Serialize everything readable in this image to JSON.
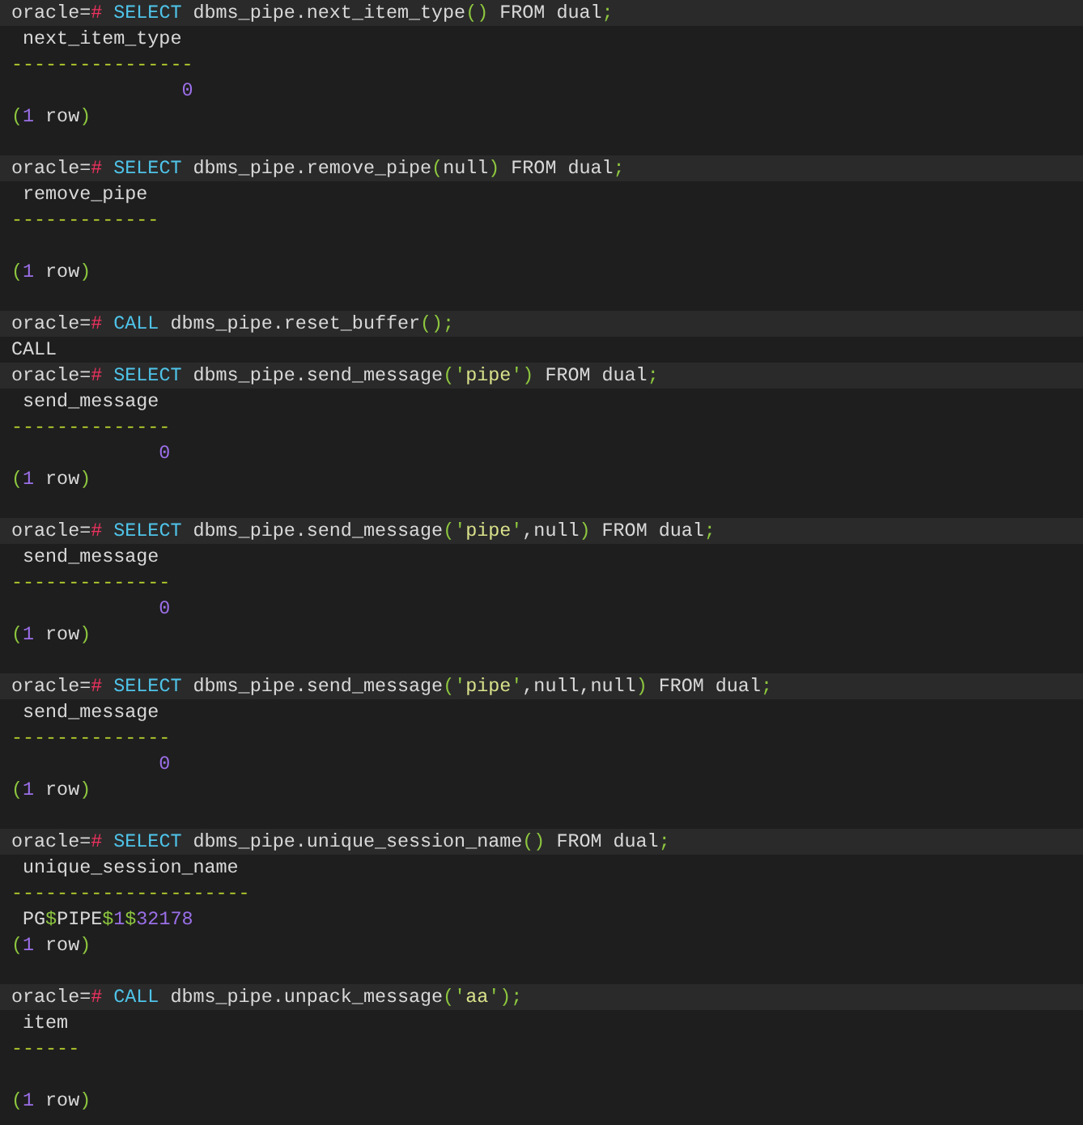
{
  "terminal": {
    "lines": [
      {
        "kind": "command",
        "tokens": [
          {
            "kind": "plain",
            "text": "oracle="
          },
          {
            "kind": "hash",
            "text": "#"
          },
          {
            "kind": "keyword",
            "text": " SELECT"
          },
          {
            "kind": "plain",
            "text": " dbms_pipe.next_item_type"
          },
          {
            "kind": "punct",
            "text": "()"
          },
          {
            "kind": "plain",
            "text": " FROM dual"
          },
          {
            "kind": "punct",
            "text": ";"
          }
        ]
      },
      {
        "kind": "header",
        "tokens": [
          {
            "kind": "plain",
            "text": " next_item_type"
          }
        ]
      },
      {
        "kind": "rule",
        "tokens": [
          {
            "kind": "dashes",
            "text": "----------------"
          }
        ]
      },
      {
        "kind": "value",
        "tokens": [
          {
            "kind": "number",
            "text": "               0"
          }
        ]
      },
      {
        "kind": "footer",
        "tokens": [
          {
            "kind": "punct",
            "text": "("
          },
          {
            "kind": "number",
            "text": "1"
          },
          {
            "kind": "plain",
            "text": " row"
          },
          {
            "kind": "punct",
            "text": ")"
          }
        ]
      },
      {
        "kind": "blank"
      },
      {
        "kind": "command",
        "tokens": [
          {
            "kind": "plain",
            "text": "oracle="
          },
          {
            "kind": "hash",
            "text": "#"
          },
          {
            "kind": "keyword",
            "text": " SELECT"
          },
          {
            "kind": "plain",
            "text": " dbms_pipe.remove_pipe"
          },
          {
            "kind": "punct",
            "text": "("
          },
          {
            "kind": "plain",
            "text": "null"
          },
          {
            "kind": "punct",
            "text": ")"
          },
          {
            "kind": "plain",
            "text": " FROM dual"
          },
          {
            "kind": "punct",
            "text": ";"
          }
        ]
      },
      {
        "kind": "header",
        "tokens": [
          {
            "kind": "plain",
            "text": " remove_pipe"
          }
        ]
      },
      {
        "kind": "rule",
        "tokens": [
          {
            "kind": "dashes",
            "text": "-------------"
          }
        ]
      },
      {
        "kind": "blank"
      },
      {
        "kind": "footer",
        "tokens": [
          {
            "kind": "punct",
            "text": "("
          },
          {
            "kind": "number",
            "text": "1"
          },
          {
            "kind": "plain",
            "text": " row"
          },
          {
            "kind": "punct",
            "text": ")"
          }
        ]
      },
      {
        "kind": "blank"
      },
      {
        "kind": "command",
        "tokens": [
          {
            "kind": "plain",
            "text": "oracle="
          },
          {
            "kind": "hash",
            "text": "#"
          },
          {
            "kind": "keyword",
            "text": " CALL"
          },
          {
            "kind": "plain",
            "text": " dbms_pipe.reset_buffer"
          },
          {
            "kind": "punct",
            "text": "();"
          }
        ]
      },
      {
        "kind": "echo",
        "tokens": [
          {
            "kind": "plain",
            "text": "CALL"
          }
        ]
      },
      {
        "kind": "command",
        "tokens": [
          {
            "kind": "plain",
            "text": "oracle="
          },
          {
            "kind": "hash",
            "text": "#"
          },
          {
            "kind": "keyword",
            "text": " SELECT"
          },
          {
            "kind": "plain",
            "text": " dbms_pipe.send_message"
          },
          {
            "kind": "punct",
            "text": "('"
          },
          {
            "kind": "string",
            "text": "pipe"
          },
          {
            "kind": "punct",
            "text": "')"
          },
          {
            "kind": "plain",
            "text": " FROM dual"
          },
          {
            "kind": "punct",
            "text": ";"
          }
        ]
      },
      {
        "kind": "header",
        "tokens": [
          {
            "kind": "plain",
            "text": " send_message"
          }
        ]
      },
      {
        "kind": "rule",
        "tokens": [
          {
            "kind": "dashes",
            "text": "--------------"
          }
        ]
      },
      {
        "kind": "value",
        "tokens": [
          {
            "kind": "number",
            "text": "             0"
          }
        ]
      },
      {
        "kind": "footer",
        "tokens": [
          {
            "kind": "punct",
            "text": "("
          },
          {
            "kind": "number",
            "text": "1"
          },
          {
            "kind": "plain",
            "text": " row"
          },
          {
            "kind": "punct",
            "text": ")"
          }
        ]
      },
      {
        "kind": "blank"
      },
      {
        "kind": "command",
        "tokens": [
          {
            "kind": "plain",
            "text": "oracle="
          },
          {
            "kind": "hash",
            "text": "#"
          },
          {
            "kind": "keyword",
            "text": " SELECT"
          },
          {
            "kind": "plain",
            "text": " dbms_pipe.send_message"
          },
          {
            "kind": "punct",
            "text": "('"
          },
          {
            "kind": "string",
            "text": "pipe"
          },
          {
            "kind": "punct",
            "text": "'"
          },
          {
            "kind": "plain",
            "text": ",null"
          },
          {
            "kind": "punct",
            "text": ")"
          },
          {
            "kind": "plain",
            "text": " FROM dual"
          },
          {
            "kind": "punct",
            "text": ";"
          }
        ]
      },
      {
        "kind": "header",
        "tokens": [
          {
            "kind": "plain",
            "text": " send_message"
          }
        ]
      },
      {
        "kind": "rule",
        "tokens": [
          {
            "kind": "dashes",
            "text": "--------------"
          }
        ]
      },
      {
        "kind": "value",
        "tokens": [
          {
            "kind": "number",
            "text": "             0"
          }
        ]
      },
      {
        "kind": "footer",
        "tokens": [
          {
            "kind": "punct",
            "text": "("
          },
          {
            "kind": "number",
            "text": "1"
          },
          {
            "kind": "plain",
            "text": " row"
          },
          {
            "kind": "punct",
            "text": ")"
          }
        ]
      },
      {
        "kind": "blank"
      },
      {
        "kind": "command",
        "tokens": [
          {
            "kind": "plain",
            "text": "oracle="
          },
          {
            "kind": "hash",
            "text": "#"
          },
          {
            "kind": "keyword",
            "text": " SELECT"
          },
          {
            "kind": "plain",
            "text": " dbms_pipe.send_message"
          },
          {
            "kind": "punct",
            "text": "('"
          },
          {
            "kind": "string",
            "text": "pipe"
          },
          {
            "kind": "punct",
            "text": "'"
          },
          {
            "kind": "plain",
            "text": ",null,null"
          },
          {
            "kind": "punct",
            "text": ")"
          },
          {
            "kind": "plain",
            "text": " FROM dual"
          },
          {
            "kind": "punct",
            "text": ";"
          }
        ]
      },
      {
        "kind": "header",
        "tokens": [
          {
            "kind": "plain",
            "text": " send_message"
          }
        ]
      },
      {
        "kind": "rule",
        "tokens": [
          {
            "kind": "dashes",
            "text": "--------------"
          }
        ]
      },
      {
        "kind": "value",
        "tokens": [
          {
            "kind": "number",
            "text": "             0"
          }
        ]
      },
      {
        "kind": "footer",
        "tokens": [
          {
            "kind": "punct",
            "text": "("
          },
          {
            "kind": "number",
            "text": "1"
          },
          {
            "kind": "plain",
            "text": " row"
          },
          {
            "kind": "punct",
            "text": ")"
          }
        ]
      },
      {
        "kind": "blank"
      },
      {
        "kind": "command",
        "tokens": [
          {
            "kind": "plain",
            "text": "oracle="
          },
          {
            "kind": "hash",
            "text": "#"
          },
          {
            "kind": "keyword",
            "text": " SELECT"
          },
          {
            "kind": "plain",
            "text": " dbms_pipe.unique_session_name"
          },
          {
            "kind": "punct",
            "text": "()"
          },
          {
            "kind": "plain",
            "text": " FROM dual"
          },
          {
            "kind": "punct",
            "text": ";"
          }
        ]
      },
      {
        "kind": "header",
        "tokens": [
          {
            "kind": "plain",
            "text": " unique_session_name"
          }
        ]
      },
      {
        "kind": "rule",
        "tokens": [
          {
            "kind": "dashes",
            "text": "---------------------"
          }
        ]
      },
      {
        "kind": "value",
        "tokens": [
          {
            "kind": "plain",
            "text": " PG"
          },
          {
            "kind": "punct",
            "text": "$"
          },
          {
            "kind": "plain",
            "text": "PIPE"
          },
          {
            "kind": "punct",
            "text": "$"
          },
          {
            "kind": "number",
            "text": "1"
          },
          {
            "kind": "punct",
            "text": "$"
          },
          {
            "kind": "number",
            "text": "32178"
          }
        ]
      },
      {
        "kind": "footer",
        "tokens": [
          {
            "kind": "punct",
            "text": "("
          },
          {
            "kind": "number",
            "text": "1"
          },
          {
            "kind": "plain",
            "text": " row"
          },
          {
            "kind": "punct",
            "text": ")"
          }
        ]
      },
      {
        "kind": "blank"
      },
      {
        "kind": "command",
        "tokens": [
          {
            "kind": "plain",
            "text": "oracle="
          },
          {
            "kind": "hash",
            "text": "#"
          },
          {
            "kind": "keyword",
            "text": " CALL"
          },
          {
            "kind": "plain",
            "text": " dbms_pipe.unpack_message"
          },
          {
            "kind": "punct",
            "text": "('"
          },
          {
            "kind": "string",
            "text": "aa"
          },
          {
            "kind": "punct",
            "text": "');"
          }
        ]
      },
      {
        "kind": "header",
        "tokens": [
          {
            "kind": "plain",
            "text": " item"
          }
        ]
      },
      {
        "kind": "rule",
        "tokens": [
          {
            "kind": "dashes",
            "text": "------"
          }
        ]
      },
      {
        "kind": "blank"
      },
      {
        "kind": "footer",
        "tokens": [
          {
            "kind": "punct",
            "text": "("
          },
          {
            "kind": "number",
            "text": "1"
          },
          {
            "kind": "plain",
            "text": " row"
          },
          {
            "kind": "punct",
            "text": ")"
          }
        ]
      }
    ]
  }
}
